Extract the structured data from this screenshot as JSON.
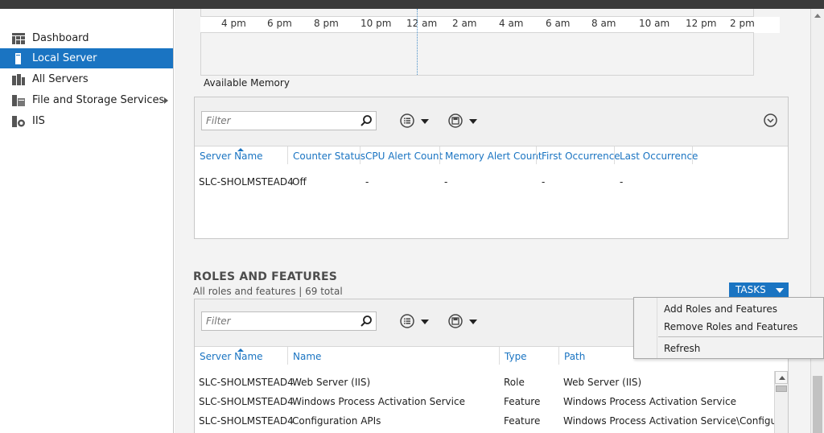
{
  "sidebar": {
    "items": [
      {
        "label": "Dashboard",
        "icon": "dashboard-icon"
      },
      {
        "label": "Local Server",
        "icon": "server-icon",
        "active": true
      },
      {
        "label": "All Servers",
        "icon": "servers-icon"
      },
      {
        "label": "File and Storage Services",
        "icon": "storage-icon",
        "has_submenu": true
      },
      {
        "label": "IIS",
        "icon": "iis-icon"
      }
    ]
  },
  "memory_chart": {
    "ticks": [
      "4 pm",
      "6 pm",
      "8 pm",
      "10 pm",
      "12 am",
      "2 am",
      "4 am",
      "6 am",
      "8 am",
      "10 am",
      "12 pm",
      "2 pm"
    ],
    "title": "Available Memory"
  },
  "performance": {
    "filter_placeholder": "Filter",
    "columns": [
      "Server Name",
      "Counter Status",
      "CPU Alert Count",
      "Memory Alert Count",
      "First Occurrence",
      "Last Occurrence"
    ],
    "rows": [
      [
        "SLC-SHOLMSTEAD4",
        "Off",
        "-",
        "-",
        "-",
        "-"
      ]
    ]
  },
  "roles": {
    "title": "ROLES AND FEATURES",
    "subtitle": "All roles and features | 69 total",
    "tasks_label": "TASKS",
    "filter_placeholder": "Filter",
    "columns": [
      "Server Name",
      "Name",
      "Type",
      "Path"
    ],
    "rows": [
      [
        "SLC-SHOLMSTEAD4",
        "Web Server (IIS)",
        "Role",
        "Web Server (IIS)"
      ],
      [
        "SLC-SHOLMSTEAD4",
        "Windows Process Activation Service",
        "Feature",
        "Windows Process Activation Service"
      ],
      [
        "SLC-SHOLMSTEAD4",
        "Configuration APIs",
        "Feature",
        "Windows Process Activation Service\\Configuration APIs"
      ]
    ]
  },
  "tasks_menu": {
    "items": [
      "Add Roles and Features",
      "Remove Roles and Features",
      "Refresh"
    ]
  },
  "colors": {
    "accent": "#1a74c2",
    "header_text": "#1a74c2",
    "panel_bg": "#f3f3f3"
  }
}
